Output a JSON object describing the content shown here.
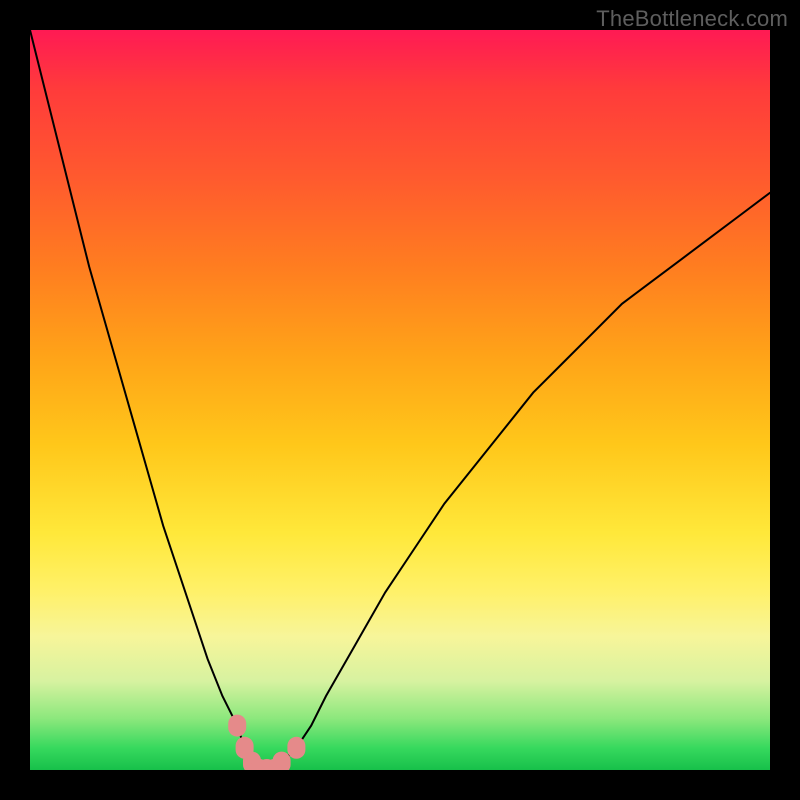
{
  "watermark": "TheBottleneck.com",
  "gradient_colors": {
    "top": "#ff1a54",
    "mid_upper": "#ff7d20",
    "mid": "#ffe83a",
    "lower": "#8de87d",
    "bottom": "#17c04a"
  },
  "chart_data": {
    "type": "line",
    "title": "",
    "xlabel": "",
    "ylabel": "",
    "xlim": [
      0,
      100
    ],
    "ylim": [
      0,
      100
    ],
    "x": [
      0,
      2,
      4,
      6,
      8,
      10,
      12,
      14,
      16,
      18,
      20,
      22,
      24,
      26,
      28,
      29,
      30,
      31,
      32,
      33,
      34,
      36,
      38,
      40,
      44,
      48,
      52,
      56,
      60,
      64,
      68,
      72,
      76,
      80,
      84,
      88,
      92,
      96,
      100
    ],
    "y": [
      100,
      92,
      84,
      76,
      68,
      61,
      54,
      47,
      40,
      33,
      27,
      21,
      15,
      10,
      6,
      3,
      1,
      0,
      0,
      0,
      1,
      3,
      6,
      10,
      17,
      24,
      30,
      36,
      41,
      46,
      51,
      55,
      59,
      63,
      66,
      69,
      72,
      75,
      78
    ],
    "minimum": {
      "x": 31,
      "y": 0
    },
    "markers": [
      {
        "x": 28,
        "y": 6
      },
      {
        "x": 29,
        "y": 3
      },
      {
        "x": 30,
        "y": 1
      },
      {
        "x": 31,
        "y": 0
      },
      {
        "x": 32,
        "y": 0
      },
      {
        "x": 33,
        "y": 0
      },
      {
        "x": 34,
        "y": 1
      },
      {
        "x": 36,
        "y": 3
      }
    ]
  }
}
